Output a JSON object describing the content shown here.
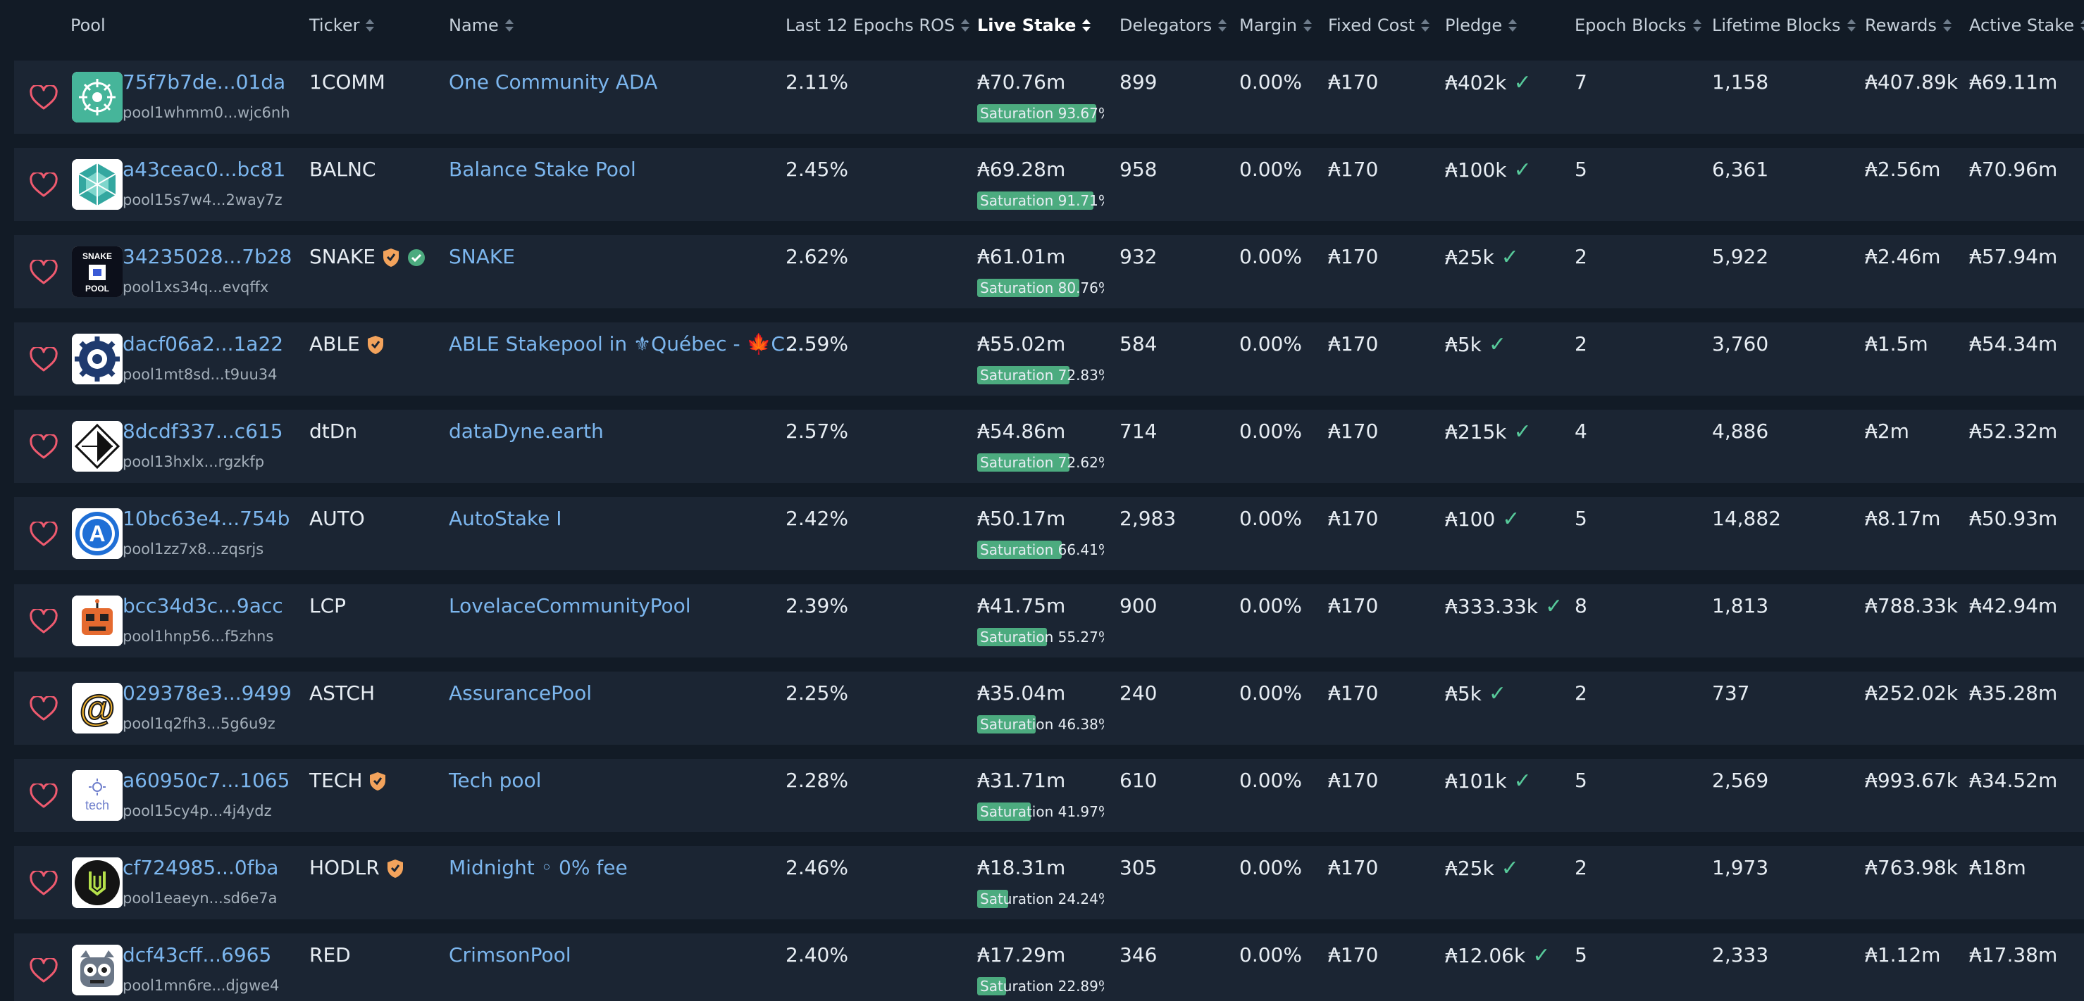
{
  "headers": {
    "pool": "Pool",
    "ticker": "Ticker",
    "name": "Name",
    "ros": "Last 12 Epochs ROS",
    "live_stake": "Live Stake",
    "delegators": "Delegators",
    "margin": "Margin",
    "fixed_cost": "Fixed Cost",
    "pledge": "Pledge",
    "epoch_blocks": "Epoch Blocks",
    "lifetime_blocks": "Lifetime Blocks",
    "rewards": "Rewards",
    "active_stake": "Active Stake"
  },
  "sort": {
    "column": "live_stake",
    "direction": "desc"
  },
  "colors": {
    "link": "#7cb6ee",
    "saturation": "#4cab7f",
    "check": "#57c99a",
    "shield": "#f3a35c",
    "verified": "#4cab7f"
  },
  "rows": [
    {
      "pool_id": "75f7b7de...01da",
      "pool_hash": "pool1whmm0...wjc6nh",
      "ticker": "1COMM",
      "shield": false,
      "verified": false,
      "name": "One Community ADA",
      "ros": "2.11%",
      "live_stake": "₳70.76m",
      "saturation": "Saturation 93.67%",
      "saturation_pct": 93.67,
      "delegators": "899",
      "margin": "0.00%",
      "fixed_cost": "₳170",
      "pledge": "₳402k",
      "pledge_check": "✓",
      "epoch_blocks": "7",
      "lifetime_blocks": "1,158",
      "rewards": "₳407.89k",
      "active_stake": "₳69.11m",
      "logo": "community-logo"
    },
    {
      "pool_id": "a43ceac0...bc81",
      "pool_hash": "pool15s7w4...2way7z",
      "ticker": "BALNC",
      "shield": false,
      "verified": false,
      "name": "Balance Stake Pool",
      "ros": "2.45%",
      "live_stake": "₳69.28m",
      "saturation": "Saturation 91.71%",
      "saturation_pct": 91.71,
      "delegators": "958",
      "margin": "0.00%",
      "fixed_cost": "₳170",
      "pledge": "₳100k",
      "pledge_check": "✓",
      "epoch_blocks": "5",
      "lifetime_blocks": "6,361",
      "rewards": "₳2.56m",
      "active_stake": "₳70.96m",
      "logo": "balance-logo"
    },
    {
      "pool_id": "34235028...7b28",
      "pool_hash": "pool1xs34q...evqffx",
      "ticker": "SNAKE",
      "shield": true,
      "verified": true,
      "name": "SNAKE",
      "ros": "2.62%",
      "live_stake": "₳61.01m",
      "saturation": "Saturation 80.76%",
      "saturation_pct": 80.76,
      "delegators": "932",
      "margin": "0.00%",
      "fixed_cost": "₳170",
      "pledge": "₳25k",
      "pledge_check": "✓",
      "epoch_blocks": "2",
      "lifetime_blocks": "5,922",
      "rewards": "₳2.46m",
      "active_stake": "₳57.94m",
      "logo": "snake-logo",
      "logo_text_top": "SNAKE",
      "logo_text_bottom": "POOL"
    },
    {
      "pool_id": "dacf06a2...1a22",
      "pool_hash": "pool1mt8sd...t9uu34",
      "ticker": "ABLE",
      "shield": true,
      "verified": false,
      "name": "ABLE Stakepool in ⚜Québec - 🍁C...",
      "ros": "2.59%",
      "live_stake": "₳55.02m",
      "saturation": "Saturation 72.83%",
      "saturation_pct": 72.83,
      "delegators": "584",
      "margin": "0.00%",
      "fixed_cost": "₳170",
      "pledge": "₳5k",
      "pledge_check": "✓",
      "epoch_blocks": "2",
      "lifetime_blocks": "3,760",
      "rewards": "₳1.5m",
      "active_stake": "₳54.34m",
      "logo": "gear-logo"
    },
    {
      "pool_id": "8dcdf337...c615",
      "pool_hash": "pool13hxlx...rgzkfp",
      "ticker": "dtDn",
      "shield": false,
      "verified": false,
      "name": "dataDyne.earth",
      "ros": "2.57%",
      "live_stake": "₳54.86m",
      "saturation": "Saturation 72.62%",
      "saturation_pct": 72.62,
      "delegators": "714",
      "margin": "0.00%",
      "fixed_cost": "₳170",
      "pledge": "₳215k",
      "pledge_check": "✓",
      "epoch_blocks": "4",
      "lifetime_blocks": "4,886",
      "rewards": "₳2m",
      "active_stake": "₳52.32m",
      "logo": "datadyne-logo"
    },
    {
      "pool_id": "10bc63e4...754b",
      "pool_hash": "pool1zz7x8...zqsrjs",
      "ticker": "AUTO",
      "shield": false,
      "verified": false,
      "name": "AutoStake I",
      "ros": "2.42%",
      "live_stake": "₳50.17m",
      "saturation": "Saturation 66.41%",
      "saturation_pct": 66.41,
      "delegators": "2,983",
      "margin": "0.00%",
      "fixed_cost": "₳170",
      "pledge": "₳100",
      "pledge_check": "✓",
      "epoch_blocks": "5",
      "lifetime_blocks": "14,882",
      "rewards": "₳8.17m",
      "active_stake": "₳50.93m",
      "logo": "autostake-logo",
      "logo_text_top": "A"
    },
    {
      "pool_id": "bcc34d3c...9acc",
      "pool_hash": "pool1hnp56...f5zhns",
      "ticker": "LCP",
      "shield": false,
      "verified": false,
      "name": "LovelaceCommunityPool",
      "ros": "2.39%",
      "live_stake": "₳41.75m",
      "saturation": "Saturation 55.27%",
      "saturation_pct": 55.27,
      "delegators": "900",
      "margin": "0.00%",
      "fixed_cost": "₳170",
      "pledge": "₳333.33k",
      "pledge_check": "✓",
      "epoch_blocks": "8",
      "lifetime_blocks": "1,813",
      "rewards": "₳788.33k",
      "active_stake": "₳42.94m",
      "logo": "robot-logo"
    },
    {
      "pool_id": "029378e3...9499",
      "pool_hash": "pool1q2fh3...5g6u9z",
      "ticker": "ASTCH",
      "shield": false,
      "verified": false,
      "name": "AssurancePool",
      "ros": "2.25%",
      "live_stake": "₳35.04m",
      "saturation": "Saturation 46.38%",
      "saturation_pct": 46.38,
      "delegators": "240",
      "margin": "0.00%",
      "fixed_cost": "₳170",
      "pledge": "₳5k",
      "pledge_check": "✓",
      "epoch_blocks": "2",
      "lifetime_blocks": "737",
      "rewards": "₳252.02k",
      "active_stake": "₳35.28m",
      "logo": "at-sign-logo",
      "logo_text_top": "@"
    },
    {
      "pool_id": "a60950c7...1065",
      "pool_hash": "pool15cy4p...4j4ydz",
      "ticker": "TECH",
      "shield": true,
      "verified": false,
      "name": "Tech pool",
      "ros": "2.28%",
      "live_stake": "₳31.71m",
      "saturation": "Saturation 41.97%",
      "saturation_pct": 41.97,
      "delegators": "610",
      "margin": "0.00%",
      "fixed_cost": "₳170",
      "pledge": "₳101k",
      "pledge_check": "✓",
      "epoch_blocks": "5",
      "lifetime_blocks": "2,569",
      "rewards": "₳993.67k",
      "active_stake": "₳34.52m",
      "logo": "tech-logo",
      "logo_text_top": "tech"
    },
    {
      "pool_id": "cf724985...0fba",
      "pool_hash": "pool1eaeyn...sd6e7a",
      "ticker": "HODLR",
      "shield": true,
      "verified": false,
      "name": "Midnight ◦ 0% fee",
      "ros": "2.46%",
      "live_stake": "₳18.31m",
      "saturation": "Saturation 24.24%",
      "saturation_pct": 24.24,
      "delegators": "305",
      "margin": "0.00%",
      "fixed_cost": "₳170",
      "pledge": "₳25k",
      "pledge_check": "✓",
      "epoch_blocks": "2",
      "lifetime_blocks": "1,973",
      "rewards": "₳763.98k",
      "active_stake": "₳18m",
      "logo": "midnight-logo"
    },
    {
      "pool_id": "dcf43cff...6965",
      "pool_hash": "pool1mn6re...djgwe4",
      "ticker": "RED",
      "shield": false,
      "verified": false,
      "name": "CrimsonPool",
      "ros": "2.40%",
      "live_stake": "₳17.29m",
      "saturation": "Saturation 22.89%",
      "saturation_pct": 22.89,
      "delegators": "346",
      "margin": "0.00%",
      "fixed_cost": "₳170",
      "pledge": "₳12.06k",
      "pledge_check": "✓",
      "epoch_blocks": "5",
      "lifetime_blocks": "2,333",
      "rewards": "₳1.12m",
      "active_stake": "₳17.38m",
      "logo": "owl-logo"
    }
  ]
}
